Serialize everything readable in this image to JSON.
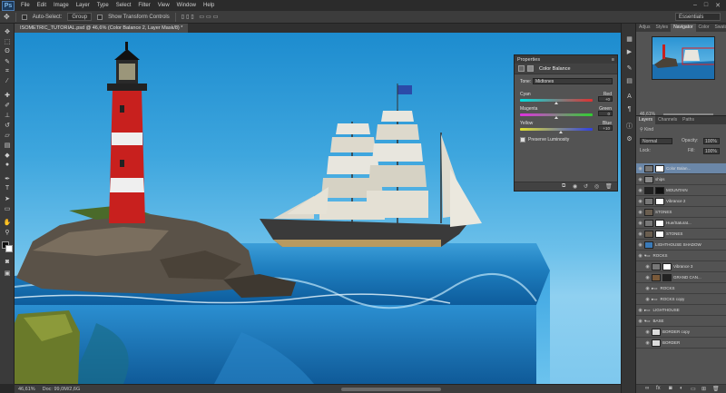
{
  "menu": {
    "app_logo": "Ps",
    "items": [
      "File",
      "Edit",
      "Image",
      "Layer",
      "Type",
      "Select",
      "Filter",
      "View",
      "Window",
      "Help"
    ]
  },
  "options": {
    "auto_select_label": "Auto-Select:",
    "auto_select_value": "Group",
    "show_transform_label": "Show Transform Controls",
    "workspace": "Essentials"
  },
  "document": {
    "tab_title": "ISOMETRIC_TUTORIAL.psd @ 46,6% (Color Balance 2, Layer Mask/8) *",
    "zoom": "46,61%",
    "doc_info": "Doc: 99,0M/2,6G"
  },
  "properties": {
    "panel_title": "Properties",
    "adjustment_title": "Color Balance",
    "tone_label": "Tone:",
    "tone_value": "Midtones",
    "sliders": [
      {
        "left": "Cyan",
        "right": "Red",
        "value": "+0",
        "position": 0.5
      },
      {
        "left": "Magenta",
        "right": "Green",
        "value": "0",
        "position": 0.5
      },
      {
        "left": "Yellow",
        "right": "Blue",
        "value": "+10",
        "position": 0.56
      }
    ],
    "preserve_luminosity": "Preserve Luminosity"
  },
  "navigator": {
    "tabs": [
      "Adjus",
      "Styles",
      "Navigator",
      "Color",
      "Swatch"
    ],
    "active_tab": "Navigator",
    "zoom": "46,61%"
  },
  "layers": {
    "tabs": [
      "Layers",
      "Channels",
      "Paths"
    ],
    "kind_label": "Kind",
    "blend_mode": "Normal",
    "opacity_label": "Opacity:",
    "opacity_value": "100%",
    "lock_label": "Lock:",
    "fill_label": "Fill:",
    "fill_value": "100%",
    "rows": [
      {
        "name": "Color Balan...",
        "selected": true
      },
      {
        "name": "ships",
        "selected": false
      },
      {
        "name": "MOUNTAIN",
        "selected": false
      },
      {
        "name": "Vibrance 2",
        "selected": false
      },
      {
        "name": "STONES",
        "selected": false
      },
      {
        "name": "Hue/Saturat...",
        "selected": false
      },
      {
        "name": "STONES",
        "selected": false
      },
      {
        "name": "LIGHTHOUSE SHADOW",
        "selected": false
      },
      {
        "name": "ROCKS",
        "selected": false
      },
      {
        "name": "Vibrance 3",
        "selected": false
      },
      {
        "name": "GRAND CAN...",
        "selected": false
      },
      {
        "name": "ROCKS",
        "selected": false
      },
      {
        "name": "ROCKS copy",
        "selected": false
      },
      {
        "name": "LIGHTHOUSE",
        "selected": false
      },
      {
        "name": "BASE",
        "selected": false
      },
      {
        "name": "BORDER copy",
        "selected": false
      },
      {
        "name": "BORDER",
        "selected": false
      }
    ]
  },
  "colors": {
    "sky": "#2a94d4",
    "selected_layer": "#6b87a8",
    "panel_bg": "#535353",
    "lighthouse_red": "#c8201e"
  }
}
